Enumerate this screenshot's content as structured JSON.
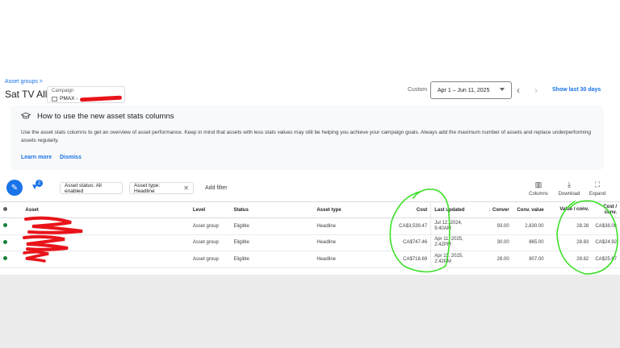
{
  "header": {
    "breadcrumb": "Asset groups >",
    "title": "Sat TV All",
    "campaign_label": "Campaign",
    "campaign_value": "PMAX -",
    "custom_label": "Custom",
    "date_range": "Apr 1 – Jun 11, 2025",
    "show_last": "Show last 30 days"
  },
  "info": {
    "title": "How to use the new asset stats columns",
    "body": "Use the asset stats columns to get an overview of asset performance. Keep in mind that assets with less stats values may still be helping you achieve your campaign goals. Always add the maximum number of assets and replace underperforming assets regularly.",
    "learn_more": "Learn more",
    "dismiss": "Dismiss"
  },
  "toolbar": {
    "filter_count": "2",
    "chip_status": "Asset status: All enabled",
    "chip_type": "Asset type: Headline",
    "add_filter": "Add filter",
    "columns": "Columns",
    "download": "Download",
    "expand": "Expand"
  },
  "table": {
    "headers": {
      "asset": "Asset",
      "level": "Level",
      "status": "Status",
      "asset_type": "Asset type",
      "cost": "Cost",
      "last_updated": "Last updated",
      "conversions": "Conver",
      "conv_value": "Conv. value",
      "value_conv": "Value / conv.",
      "cost_conv": "Cost / conv."
    },
    "rows": [
      {
        "level": "Asset group",
        "status": "Eligible",
        "asset_type": "Headline",
        "cost": "CA$3,539.47",
        "last_updated": "Jul 12, 2024, 9:40AM",
        "conversions": "93.00",
        "conv_value": "2,630.00",
        "value_conv": "28.28",
        "cost_conv": "CA$38.06"
      },
      {
        "level": "Asset group",
        "status": "Eligible",
        "asset_type": "Headline",
        "cost": "CA$747.46",
        "last_updated": "Apr 11, 2025, 2:42PM",
        "conversions": "30.00",
        "conv_value": "865.00",
        "value_conv": "28.83",
        "cost_conv": "CA$24.92"
      },
      {
        "level": "Asset group",
        "status": "Eligible",
        "asset_type": "Headline",
        "cost": "CA$718.69",
        "last_updated": "Apr 11, 2025, 2:42PM",
        "conversions": "28.00",
        "conv_value": "807.00",
        "value_conv": "28.82",
        "cost_conv": "CA$25.67"
      }
    ]
  },
  "colors": {
    "accent": "#1a73e8",
    "status_ok": "#188038",
    "redaction": "#e8141a",
    "annotation": "#3ee02a"
  }
}
